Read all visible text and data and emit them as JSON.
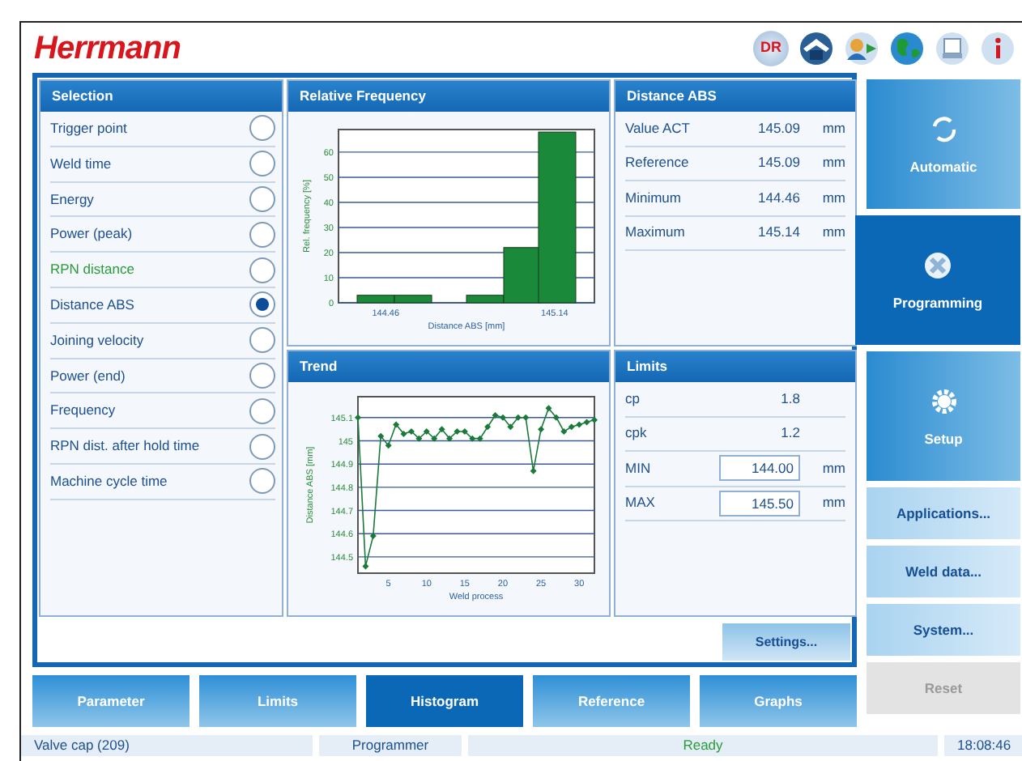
{
  "header": {
    "logo": "Herrmann",
    "badge": "DR"
  },
  "selection": {
    "title": "Selection",
    "items": [
      {
        "label": "Trigger point",
        "selected": false,
        "color": "#1d4f8f"
      },
      {
        "label": "Weld time",
        "selected": false,
        "color": "#1d4f8f"
      },
      {
        "label": "Energy",
        "selected": false,
        "color": "#1d4f8f"
      },
      {
        "label": "Power (peak)",
        "selected": false,
        "color": "#1d4f8f"
      },
      {
        "label": "RPN distance",
        "selected": false,
        "color": "#2a9a3a"
      },
      {
        "label": "Distance ABS",
        "selected": true,
        "color": "#1d4f8f"
      },
      {
        "label": "Joining velocity",
        "selected": false,
        "color": "#1d4f8f"
      },
      {
        "label": "Power (end)",
        "selected": false,
        "color": "#1d4f8f"
      },
      {
        "label": "Frequency",
        "selected": false,
        "color": "#1d4f8f"
      },
      {
        "label": "RPN dist. after hold time",
        "selected": false,
        "color": "#1d4f8f"
      },
      {
        "label": "Machine cycle time",
        "selected": false,
        "color": "#1d4f8f"
      }
    ]
  },
  "histogram": {
    "title": "Relative Frequency",
    "chart_data": {
      "type": "bar",
      "xlabel": "Distance ABS [mm]",
      "ylabel": "Rel. frequency [%]",
      "x": [
        144.42,
        144.57,
        144.71,
        144.86,
        145.01,
        145.15
      ],
      "series": [
        {
          "color": "#1a8a3a",
          "values": [
            3,
            3,
            0,
            3,
            22,
            68
          ]
        }
      ],
      "grid": true,
      "xlim": [
        144.27,
        145.3
      ],
      "ylim": [
        0,
        69
      ],
      "xticks": [
        {
          "value": 144.46,
          "label": "144.46"
        },
        {
          "value": 145.14,
          "label": "145.14"
        }
      ],
      "yticks": [
        0,
        10,
        20,
        30,
        40,
        50,
        60
      ]
    }
  },
  "trend": {
    "title": "Trend",
    "chart_data": {
      "type": "line",
      "xlabel": "Weld process",
      "ylabel": "Distance ABS [mm]",
      "x": [
        1,
        2,
        3,
        4,
        5,
        6,
        7,
        8,
        9,
        10,
        11,
        12,
        13,
        14,
        15,
        16,
        17,
        18,
        19,
        20,
        21,
        22,
        23,
        24,
        25,
        26,
        27,
        28,
        29,
        30,
        31,
        32
      ],
      "grid": true,
      "series": [
        {
          "color": "#1a7a3a",
          "marker": true,
          "values": [
            145.1,
            144.46,
            144.59,
            145.02,
            144.98,
            145.07,
            145.03,
            145.04,
            145.01,
            145.04,
            145.01,
            145.05,
            145.01,
            145.04,
            145.04,
            145.01,
            145.01,
            145.06,
            145.11,
            145.1,
            145.06,
            145.1,
            145.1,
            144.87,
            145.05,
            145.14,
            145.1,
            145.04,
            145.06,
            145.07,
            145.08,
            145.09
          ]
        }
      ],
      "xlim": [
        1,
        32
      ],
      "ylim": [
        144.43,
        145.19
      ],
      "xticks": [
        5,
        10,
        15,
        20,
        25,
        30
      ],
      "yticks": [
        {
          "value": 144.5,
          "label": "144.5"
        },
        {
          "value": 144.6,
          "label": "144.6"
        },
        {
          "value": 144.7,
          "label": "144.7"
        },
        {
          "value": 144.8,
          "label": "144.8"
        },
        {
          "value": 144.9,
          "label": "144.9"
        },
        {
          "value": 145,
          "label": "145"
        },
        {
          "value": 145.1,
          "label": "145.1"
        }
      ]
    }
  },
  "distance": {
    "title": "Distance ABS",
    "rows": [
      {
        "label": "Value ACT",
        "value": "145.09",
        "unit": "mm"
      },
      {
        "label": "Reference",
        "value": "145.09",
        "unit": "mm"
      },
      {
        "label": "Minimum",
        "value": "144.46",
        "unit": "mm"
      },
      {
        "label": "Maximum",
        "value": "145.14",
        "unit": "mm"
      }
    ]
  },
  "limits": {
    "title": "Limits",
    "rows": [
      {
        "kind": "text",
        "label": "cp",
        "value": "1.8"
      },
      {
        "kind": "text",
        "label": "cpk",
        "value": "1.2"
      },
      {
        "kind": "input",
        "label": "MIN",
        "value": "144.00",
        "unit": "mm"
      },
      {
        "kind": "input",
        "label": "MAX",
        "value": "145.50",
        "unit": "mm"
      }
    ]
  },
  "settings_button": "Settings...",
  "tabs": [
    {
      "label": "Parameter",
      "selected": false
    },
    {
      "label": "Limits",
      "selected": false
    },
    {
      "label": "Histogram",
      "selected": true
    },
    {
      "label": "Reference",
      "selected": false
    },
    {
      "label": "Graphs",
      "selected": false
    }
  ],
  "nav": [
    {
      "kind": "big",
      "label": "Automatic",
      "selected": false,
      "disabled": false
    },
    {
      "kind": "big",
      "label": "Programming",
      "selected": true,
      "disabled": false
    },
    {
      "kind": "big",
      "label": "Setup",
      "selected": false,
      "disabled": false
    },
    {
      "kind": "small",
      "label": "Applications...",
      "selected": false,
      "disabled": false
    },
    {
      "kind": "small",
      "label": "Weld data...",
      "selected": false,
      "disabled": false
    },
    {
      "kind": "small",
      "label": "System...",
      "selected": false,
      "disabled": false
    },
    {
      "kind": "small",
      "label": "Reset",
      "selected": false,
      "disabled": true
    }
  ],
  "status_bar": {
    "product": "Valve cap (209)",
    "user": "Programmer",
    "state": "Ready",
    "time": "18:08:46"
  }
}
